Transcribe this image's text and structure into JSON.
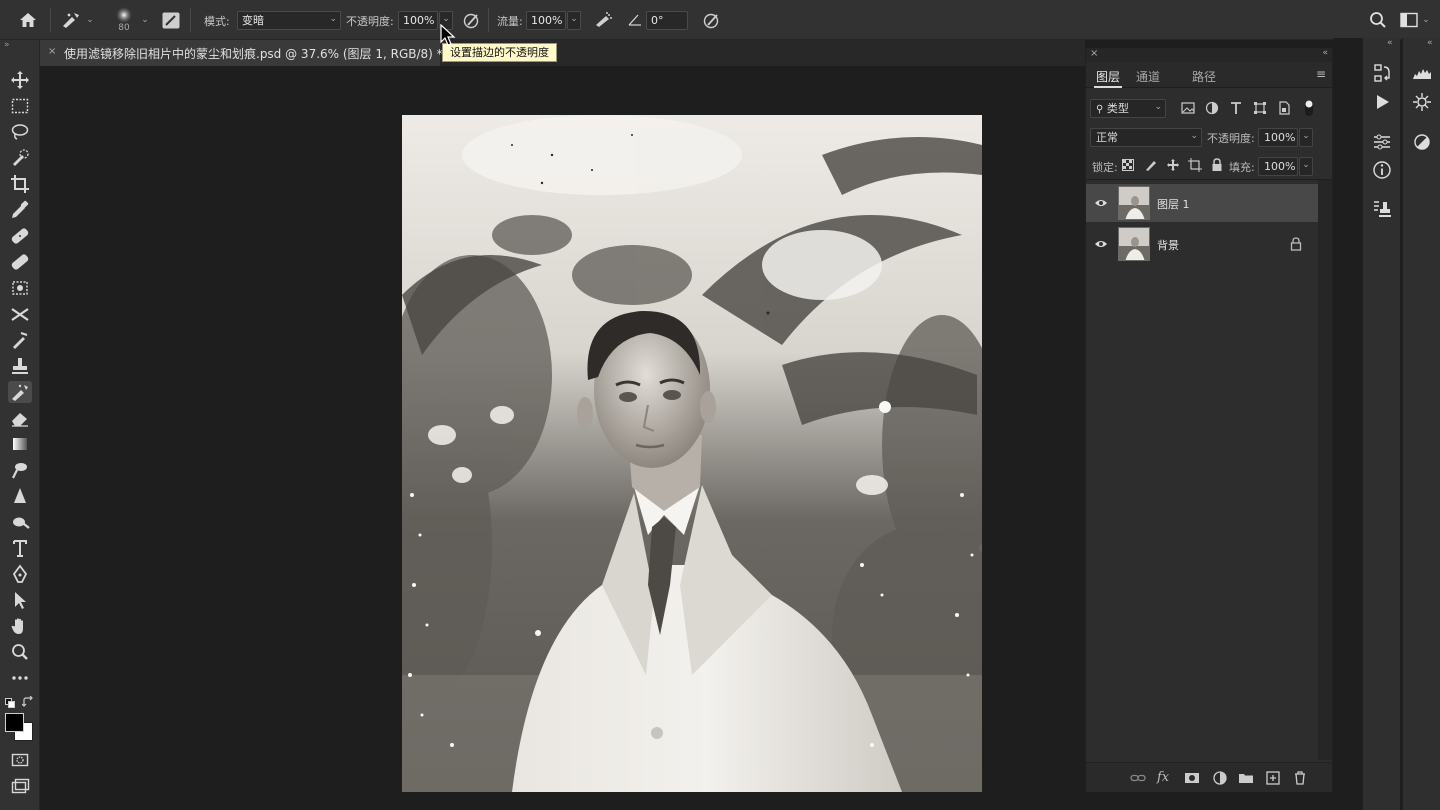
{
  "options_bar": {
    "brush_size": "80",
    "mode_label": "模式:",
    "mode_value": "变暗",
    "opacity_label": "不透明度:",
    "opacity_value": "100%",
    "flow_label": "流量:",
    "flow_value": "100%",
    "angle_value": "0°"
  },
  "document": {
    "tab_title": "使用滤镜移除旧相片中的蒙尘和划痕.psd @ 37.6% (图层 1, RGB/8) *",
    "close_glyph": "×"
  },
  "tooltip": {
    "text": "设置描边的不透明度"
  },
  "layers_panel": {
    "tabs": [
      "图层",
      "通道",
      "路径"
    ],
    "filter_value": "类型",
    "blend_mode": "正常",
    "opacity_label": "不透明度:",
    "opacity_value": "100%",
    "lock_label": "锁定:",
    "fill_label": "填充:",
    "fill_value": "100%",
    "layers": [
      {
        "name": "图层 1",
        "selected": true,
        "locked": false
      },
      {
        "name": "背景",
        "selected": false,
        "locked": true
      }
    ]
  },
  "colors": {
    "app_bg": "#1e1e1e",
    "panel_bg": "#2d2d2d",
    "selected_layer": "#484848",
    "tooltip_bg": "#fff8c8",
    "foreground_swatch": "#000000",
    "background_swatch": "#ffffff"
  },
  "icons": {
    "home": "home-icon",
    "brush_preset": "brush-preset-icon",
    "airbrush": "airbrush-icon",
    "pressure": "pressure-icon",
    "search": "search-icon",
    "workspace": "workspace-icon"
  }
}
